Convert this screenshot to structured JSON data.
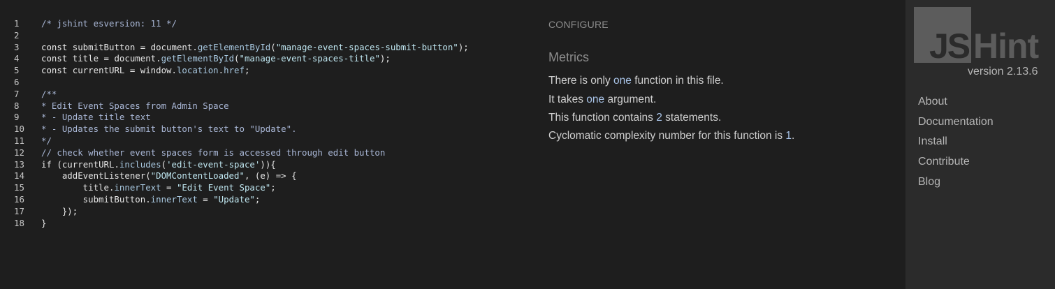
{
  "editor": {
    "lines": [
      {
        "number": "1",
        "tokens": [
          {
            "t": "/* jshint esversion: 11 */",
            "c": "comment"
          }
        ]
      },
      {
        "number": "2",
        "tokens": []
      },
      {
        "number": "3",
        "tokens": [
          {
            "t": "const ",
            "c": "kw"
          },
          {
            "t": "submitButton = document.",
            "c": "plain"
          },
          {
            "t": "getElementById",
            "c": "prop"
          },
          {
            "t": "(",
            "c": "plain"
          },
          {
            "t": "\"manage-event-spaces-submit-button\"",
            "c": "str"
          },
          {
            "t": ");",
            "c": "plain"
          }
        ]
      },
      {
        "number": "4",
        "tokens": [
          {
            "t": "const ",
            "c": "kw"
          },
          {
            "t": "title = document.",
            "c": "plain"
          },
          {
            "t": "getElementById",
            "c": "prop"
          },
          {
            "t": "(",
            "c": "plain"
          },
          {
            "t": "\"manage-event-spaces-title\"",
            "c": "str"
          },
          {
            "t": ");",
            "c": "plain"
          }
        ]
      },
      {
        "number": "5",
        "tokens": [
          {
            "t": "const ",
            "c": "kw"
          },
          {
            "t": "currentURL = window.",
            "c": "plain"
          },
          {
            "t": "location",
            "c": "prop"
          },
          {
            "t": ".",
            "c": "plain"
          },
          {
            "t": "href",
            "c": "prop"
          },
          {
            "t": ";",
            "c": "plain"
          }
        ]
      },
      {
        "number": "6",
        "tokens": []
      },
      {
        "number": "7",
        "tokens": [
          {
            "t": "/**",
            "c": "comment"
          }
        ]
      },
      {
        "number": "8",
        "tokens": [
          {
            "t": "* Edit Event Spaces from Admin Space",
            "c": "comment"
          }
        ]
      },
      {
        "number": "9",
        "tokens": [
          {
            "t": "* - Update title text",
            "c": "comment"
          }
        ]
      },
      {
        "number": "10",
        "tokens": [
          {
            "t": "* - Updates the submit button's text to \"Update\".",
            "c": "comment"
          }
        ]
      },
      {
        "number": "11",
        "tokens": [
          {
            "t": "*/",
            "c": "comment"
          }
        ]
      },
      {
        "number": "12",
        "tokens": [
          {
            "t": "// check whether event spaces form is accessed through edit button",
            "c": "comment"
          }
        ]
      },
      {
        "number": "13",
        "tokens": [
          {
            "t": "if ",
            "c": "kw"
          },
          {
            "t": "(currentURL.",
            "c": "plain"
          },
          {
            "t": "includes",
            "c": "prop"
          },
          {
            "t": "(",
            "c": "plain"
          },
          {
            "t": "'edit-event-space'",
            "c": "str"
          },
          {
            "t": ")){",
            "c": "plain"
          }
        ]
      },
      {
        "number": "14",
        "tokens": [
          {
            "t": "    addEventListener(",
            "c": "plain"
          },
          {
            "t": "\"DOMContentLoaded\"",
            "c": "str"
          },
          {
            "t": ", (e) => {",
            "c": "plain"
          }
        ]
      },
      {
        "number": "15",
        "tokens": [
          {
            "t": "        title.",
            "c": "plain"
          },
          {
            "t": "innerText",
            "c": "prop"
          },
          {
            "t": " = ",
            "c": "plain"
          },
          {
            "t": "\"Edit Event Space\"",
            "c": "str"
          },
          {
            "t": ";",
            "c": "plain"
          }
        ]
      },
      {
        "number": "16",
        "tokens": [
          {
            "t": "        submitButton.",
            "c": "plain"
          },
          {
            "t": "innerText",
            "c": "prop"
          },
          {
            "t": " = ",
            "c": "plain"
          },
          {
            "t": "\"Update\"",
            "c": "str"
          },
          {
            "t": ";",
            "c": "plain"
          }
        ]
      },
      {
        "number": "17",
        "tokens": [
          {
            "t": "    });",
            "c": "plain"
          }
        ]
      },
      {
        "number": "18",
        "tokens": [
          {
            "t": "}",
            "c": "plain"
          }
        ]
      }
    ]
  },
  "report": {
    "configure_label": "CONFIGURE",
    "metrics_title": "Metrics",
    "metrics": [
      {
        "parts": [
          {
            "t": "There is only "
          },
          {
            "t": "one",
            "hl": true
          },
          {
            "t": " function in this file."
          }
        ]
      },
      {
        "parts": [
          {
            "t": "It takes "
          },
          {
            "t": "one",
            "hl": true
          },
          {
            "t": " argument."
          }
        ]
      },
      {
        "parts": [
          {
            "t": "This function contains "
          },
          {
            "t": "2",
            "hl": true
          },
          {
            "t": " statements."
          }
        ]
      },
      {
        "parts": [
          {
            "t": "Cyclomatic complexity number for this function is "
          },
          {
            "t": "1",
            "hl": true
          },
          {
            "t": "."
          }
        ]
      }
    ]
  },
  "sidebar": {
    "logo_js": "JS",
    "logo_hint": "Hint",
    "version": "version 2.13.6",
    "nav": [
      {
        "label": "About"
      },
      {
        "label": "Documentation"
      },
      {
        "label": "Install"
      },
      {
        "label": "Contribute"
      },
      {
        "label": "Blog"
      }
    ]
  },
  "colors": {
    "background": "#1e1e1e",
    "sidebar_background": "#2b2b2b",
    "logo_gray": "#5c5c5c",
    "highlight": "#a9c4e8"
  }
}
